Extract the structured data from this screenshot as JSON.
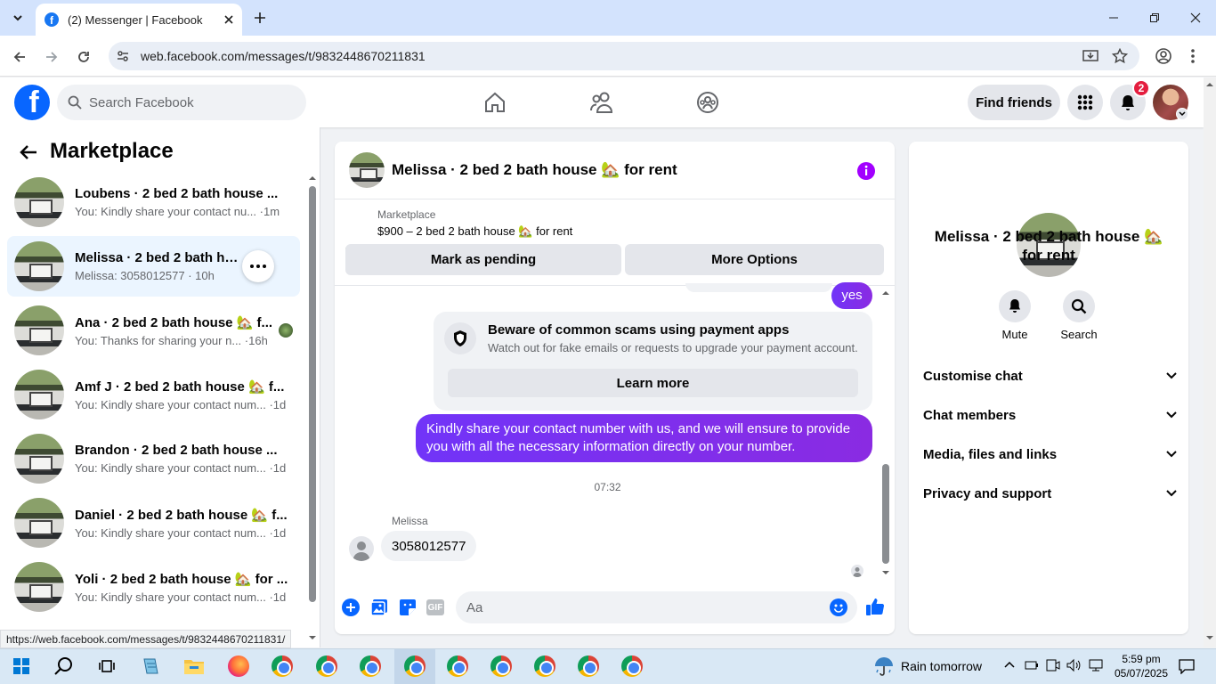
{
  "browser": {
    "tab_title": "(2) Messenger | Facebook",
    "url": "web.facebook.com/messages/t/9832448670211831",
    "status_url": "https://web.facebook.com/messages/t/9832448670211831/"
  },
  "fb_header": {
    "search_placeholder": "Search Facebook",
    "find_friends": "Find friends",
    "notification_count": "2"
  },
  "sidebar": {
    "title": "Marketplace",
    "conversations": [
      {
        "name": "Loubens · 2 bed 2 bath house ...",
        "preview": "You: Kindly share your contact nu... ·1m"
      },
      {
        "name": "Melissa · 2 bed 2 bath house ...",
        "preview": "Melissa: 3058012577 · 10h"
      },
      {
        "name": "Ana · 2 bed 2 bath house 🏡 f...",
        "preview": "You: Thanks for sharing your n... ·16h"
      },
      {
        "name": "Amf J · 2 bed 2 bath house 🏡 f...",
        "preview": "You: Kindly share your contact num... ·1d"
      },
      {
        "name": "Brandon · 2 bed 2 bath house ...",
        "preview": "You: Kindly share your contact num... ·1d"
      },
      {
        "name": "Daniel · 2 bed 2 bath house 🏡 f...",
        "preview": "You: Kindly share your contact num... ·1d"
      },
      {
        "name": "Yoli · 2 bed 2 bath house 🏡 for ...",
        "preview": "You: Kindly share your contact num... ·1d"
      }
    ]
  },
  "chat": {
    "title": "Melissa · 2 bed 2 bath house 🏡 for rent",
    "marketplace_label": "Marketplace",
    "listing": "$900 – 2 bed 2 bath house 🏡 for rent",
    "mark_pending": "Mark as pending",
    "more_options": "More Options",
    "yes_message": "yes",
    "scam_title": "Beware of common scams using payment apps",
    "scam_subtitle": "Watch out for fake emails or requests to upgrade your payment account.",
    "learn_more": "Learn more",
    "outgoing_message": "Kindly share your contact number with us, and we will ensure to provide you with all the necessary information directly on your number.",
    "timestamp": "07:32",
    "sender": "Melissa",
    "incoming_message": "3058012577",
    "composer_placeholder": "Aa"
  },
  "details": {
    "name": "Melissa · 2 bed 2 bath house 🏡 for rent",
    "mute": "Mute",
    "search": "Search",
    "sections": [
      "Customise chat",
      "Chat members",
      "Media, files and links",
      "Privacy and support"
    ]
  },
  "taskbar": {
    "weather": "Rain tomorrow",
    "time": "5:59 pm",
    "date": "05/07/2025"
  },
  "colors": {
    "fb_blue": "#0866ff",
    "outgoing_bubble": "#7b2ff7",
    "notification_red": "#e41e3f"
  }
}
